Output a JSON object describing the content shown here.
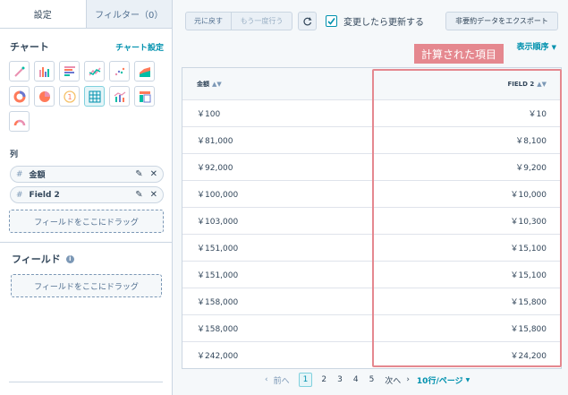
{
  "tabs": {
    "settings": "設定",
    "filters": "フィルター（0）"
  },
  "chart_section": {
    "title": "チャート",
    "settings_link": "チャート設定"
  },
  "columns_section": {
    "title": "列",
    "items": [
      {
        "label": "金額",
        "icon": "hash-icon"
      },
      {
        "label": "Field 2",
        "icon": "hash-icon"
      }
    ],
    "dropzone": "フィールドをここにドラッグ"
  },
  "field_section": {
    "title": "フィールド",
    "dropzone": "フィールドをここにドラッグ"
  },
  "toolbar": {
    "undo": "元に戻す",
    "redo": "もう一度行う",
    "auto_update": "変更したら更新する",
    "export": "非要約データをエクスポート",
    "sort_order": "表示順序"
  },
  "callout": "計算された項目",
  "table": {
    "headers": [
      "金額",
      "FIELD 2"
    ],
    "rows": [
      [
        "￥100",
        "￥10"
      ],
      [
        "￥81,000",
        "￥8,100"
      ],
      [
        "￥92,000",
        "￥9,200"
      ],
      [
        "￥100,000",
        "￥10,000"
      ],
      [
        "￥103,000",
        "￥10,300"
      ],
      [
        "￥151,000",
        "￥15,100"
      ],
      [
        "￥151,000",
        "￥15,100"
      ],
      [
        "￥158,000",
        "￥15,800"
      ],
      [
        "￥158,000",
        "￥15,800"
      ],
      [
        "￥242,000",
        "￥24,200"
      ]
    ]
  },
  "pagination": {
    "prev": "前へ",
    "pages": [
      "1",
      "2",
      "3",
      "4",
      "5"
    ],
    "current": "1",
    "next": "次へ",
    "per_page": "10行/ページ"
  },
  "colors": {
    "accent": "#0091ae",
    "highlight": "#e5888f"
  }
}
